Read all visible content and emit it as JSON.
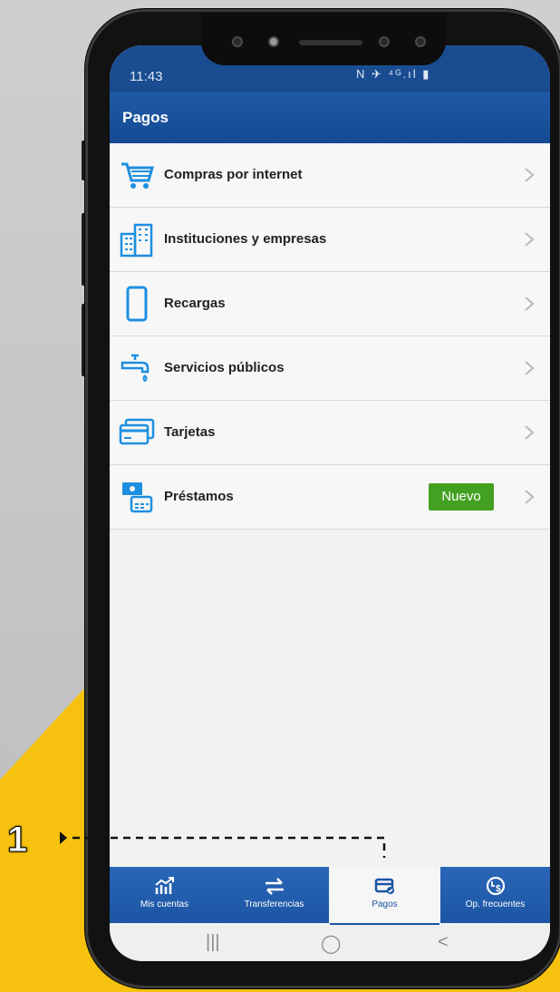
{
  "status_bar": {
    "time": "11:43",
    "icons": "N ✈ ⁴ᴳ.ıl ▮"
  },
  "header": {
    "title": "Pagos"
  },
  "menu": {
    "items": [
      {
        "label": "Compras por internet",
        "icon": "shopping-cart-icon"
      },
      {
        "label": "Instituciones y empresas",
        "icon": "building-icon"
      },
      {
        "label": "Recargas",
        "icon": "mobile-phone-icon"
      },
      {
        "label": "Servicios públicos",
        "icon": "water-faucet-icon"
      },
      {
        "label": "Tarjetas",
        "icon": "credit-card-icon"
      },
      {
        "label": "Préstamos",
        "icon": "loan-icon",
        "badge": "Nuevo"
      }
    ]
  },
  "bottom_nav": {
    "tabs": [
      {
        "label": "Mis cuentas",
        "icon": "chart-icon"
      },
      {
        "label": "Transferencias",
        "icon": "transfer-arrows-icon"
      },
      {
        "label": "Pagos",
        "icon": "payment-card-icon",
        "active": true
      },
      {
        "label": "Op. frecuentes",
        "icon": "clock-money-icon"
      }
    ]
  },
  "system_nav": {
    "recents": "|||",
    "home": "◯",
    "back": "<"
  },
  "callout": {
    "number": "1"
  },
  "colors": {
    "header_blue": "#1c55a3",
    "badge_green": "#43a020",
    "icon_blue": "#1d8fe0",
    "accent_yellow": "#f6c20f"
  }
}
